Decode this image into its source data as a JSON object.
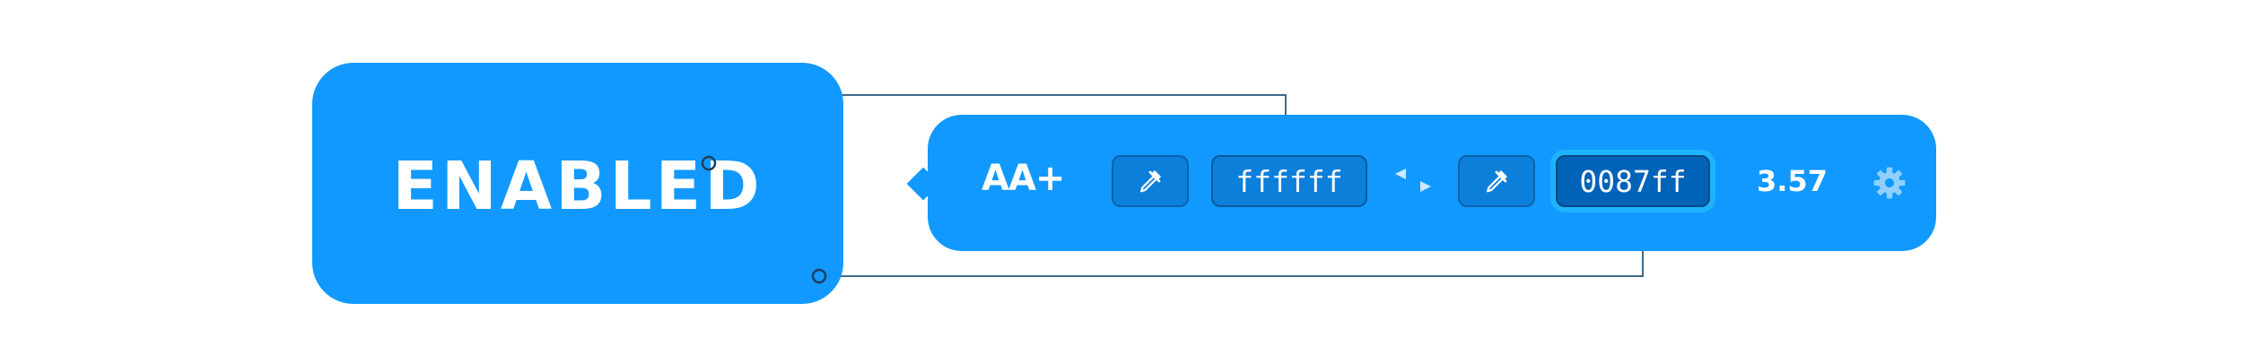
{
  "sample": {
    "text": "ENABLED",
    "background": "#1199ff",
    "foreground": "#ffffff"
  },
  "toolbar": {
    "rating": "AA+",
    "foreground": {
      "hex": "ffffff",
      "picker_icon": "eyedropper-icon"
    },
    "swap_icon": "swap-arrows-icon",
    "background": {
      "hex": "0087ff",
      "picker_icon": "eyedropper-icon",
      "selected": true
    },
    "contrast_ratio": "3.57",
    "settings_icon": "gear-icon"
  },
  "colors": {
    "accent": "#1199ff",
    "swatch": "#0c7fdb",
    "swatch_selected": "#0063b8",
    "connector": "#3d6a8a"
  }
}
